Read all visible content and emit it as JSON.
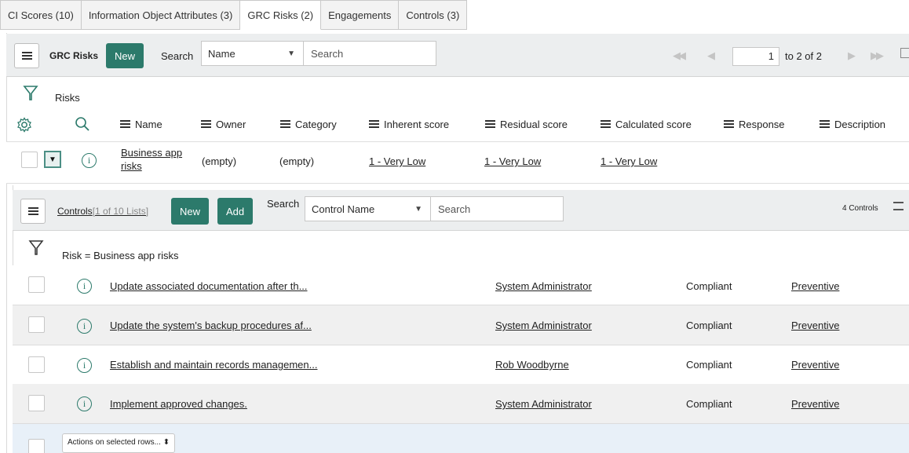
{
  "tabs": [
    {
      "label": "CI Scores (10)"
    },
    {
      "label": "Information Object Attributes (3)"
    },
    {
      "label": "GRC Risks (2)"
    },
    {
      "label": "Engagements"
    },
    {
      "label": "Controls (3)"
    }
  ],
  "grc_toolbar": {
    "title": "GRC Risks",
    "new_label": "New",
    "search_label": "Search",
    "search_field_value": "Name",
    "search_placeholder": "Search",
    "page_value": "1",
    "page_range": "to 2 of 2"
  },
  "risks_filter": {
    "label": "Risks"
  },
  "risk_columns": [
    {
      "label": "Name"
    },
    {
      "label": "Owner"
    },
    {
      "label": "Category"
    },
    {
      "label": "Inherent score"
    },
    {
      "label": "Residual score"
    },
    {
      "label": "Calculated score"
    },
    {
      "label": "Response"
    },
    {
      "label": "Description"
    }
  ],
  "risk_row": {
    "name_line1": "Business app",
    "name_line2": "risks",
    "owner": "(empty)",
    "category": "(empty)",
    "inherent_score": "1 - Very Low",
    "residual_score": "1 - Very Low",
    "calculated_score": "1 - Very Low"
  },
  "controls_toolbar": {
    "title": "Controls",
    "list_info": "[1 of 10 Lists]",
    "new_label": "New",
    "add_label": "Add",
    "search_label": "Search",
    "search_field_value": "Control Name",
    "search_placeholder": "Search",
    "count_label": "4 Controls"
  },
  "controls_filter": {
    "label": "Risk = Business app risks"
  },
  "controls": [
    {
      "name": "Update associated documentation after th...",
      "owner": "System Administrator",
      "status": "Compliant",
      "type": "Preventive"
    },
    {
      "name": "Update the system's backup procedures af...",
      "owner": "System Administrator",
      "status": "Compliant",
      "type": "Preventive"
    },
    {
      "name": "Establish and maintain records managemen...",
      "owner": "Rob Woodbyrne",
      "status": "Compliant",
      "type": "Preventive"
    },
    {
      "name": "Implement approved changes.",
      "owner": "System Administrator",
      "status": "Compliant",
      "type": "Preventive"
    }
  ],
  "actions": {
    "label": "Actions on selected rows..."
  },
  "colors": {
    "accent": "#2c7a6b",
    "toolbar_bg": "#eceeef",
    "row_alt": "#f0f0f0",
    "selection_bg": "#e8f0f8"
  }
}
